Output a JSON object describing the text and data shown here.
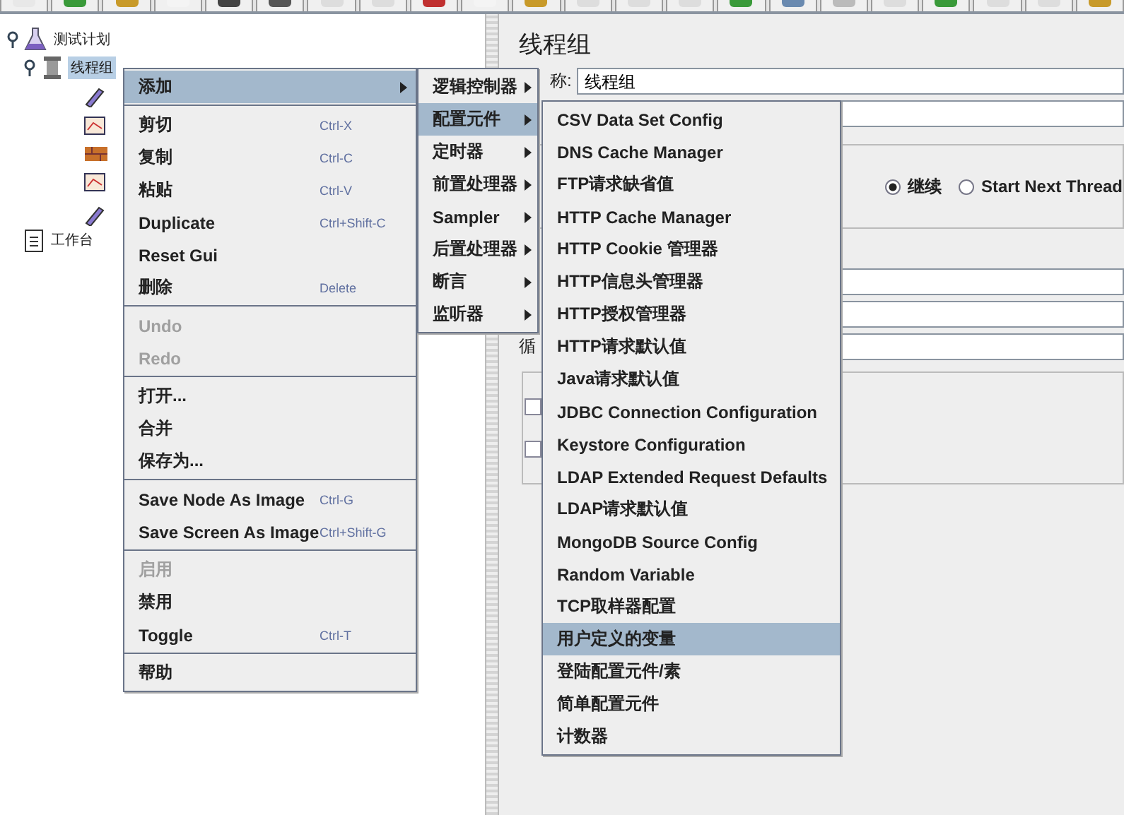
{
  "tree": [
    {
      "label": "测试计划",
      "selected": false,
      "children": [
        {
          "label": "线程组",
          "selected": true
        }
      ]
    },
    {
      "label": "工作台",
      "selected": false
    }
  ],
  "panel": {
    "title": "线程组",
    "name_label": "称:",
    "name_value": "线程组",
    "loop_label": "循",
    "checkboxes": [
      {
        "checked": false
      },
      {
        "checked": false
      }
    ],
    "radios": [
      {
        "label": "继续",
        "selected": true
      },
      {
        "label": "Start Next Thread",
        "selected": false
      }
    ]
  },
  "context_menu": [
    {
      "kind": "item",
      "label": "添加",
      "submenu": true,
      "selected": true,
      "disabled": false
    },
    {
      "kind": "separator"
    },
    {
      "kind": "item",
      "label": "剪切",
      "shortcut": "Ctrl-X",
      "selected": false,
      "disabled": false
    },
    {
      "kind": "item",
      "label": "复制",
      "shortcut": "Ctrl-C",
      "selected": false,
      "disabled": false
    },
    {
      "kind": "item",
      "label": "粘贴",
      "shortcut": "Ctrl-V",
      "selected": false,
      "disabled": false
    },
    {
      "kind": "item",
      "label": "Duplicate",
      "shortcut": "Ctrl+Shift-C",
      "selected": false,
      "disabled": false
    },
    {
      "kind": "item",
      "label": "Reset Gui",
      "selected": false,
      "disabled": false
    },
    {
      "kind": "item",
      "label": "删除",
      "shortcut": "Delete",
      "selected": false,
      "disabled": false
    },
    {
      "kind": "separator"
    },
    {
      "kind": "item",
      "label": "Undo",
      "selected": false,
      "disabled": true
    },
    {
      "kind": "item",
      "label": "Redo",
      "selected": false,
      "disabled": true
    },
    {
      "kind": "separator"
    },
    {
      "kind": "item",
      "label": "打开...",
      "selected": false,
      "disabled": false
    },
    {
      "kind": "item",
      "label": "合并",
      "selected": false,
      "disabled": false
    },
    {
      "kind": "item",
      "label": "保存为...",
      "selected": false,
      "disabled": false
    },
    {
      "kind": "separator"
    },
    {
      "kind": "item",
      "label": "Save Node As Image",
      "shortcut": "Ctrl-G",
      "selected": false,
      "disabled": false
    },
    {
      "kind": "item",
      "label": "Save Screen As Image",
      "shortcut": "Ctrl+Shift-G",
      "selected": false,
      "disabled": false
    },
    {
      "kind": "separator"
    },
    {
      "kind": "item",
      "label": "启用",
      "selected": false,
      "disabled": true
    },
    {
      "kind": "item",
      "label": "禁用",
      "selected": false,
      "disabled": false
    },
    {
      "kind": "item",
      "label": "Toggle",
      "shortcut": "Ctrl-T",
      "selected": false,
      "disabled": false
    },
    {
      "kind": "separator"
    },
    {
      "kind": "item",
      "label": "帮助",
      "selected": false,
      "disabled": false
    }
  ],
  "add_submenu": [
    {
      "label": "逻辑控制器",
      "selected": false
    },
    {
      "label": "配置元件",
      "selected": true
    },
    {
      "label": "定时器",
      "selected": false
    },
    {
      "label": "前置处理器",
      "selected": false
    },
    {
      "label": "Sampler",
      "selected": false
    },
    {
      "label": "后置处理器",
      "selected": false
    },
    {
      "label": "断言",
      "selected": false
    },
    {
      "label": "监听器",
      "selected": false
    }
  ],
  "config_submenu": [
    {
      "label": "CSV Data Set Config",
      "selected": false
    },
    {
      "label": "DNS Cache Manager",
      "selected": false
    },
    {
      "label": "FTP请求缺省值",
      "selected": false
    },
    {
      "label": "HTTP Cache Manager",
      "selected": false
    },
    {
      "label": "HTTP Cookie 管理器",
      "selected": false
    },
    {
      "label": "HTTP信息头管理器",
      "selected": false
    },
    {
      "label": "HTTP授权管理器",
      "selected": false
    },
    {
      "label": "HTTP请求默认值",
      "selected": false
    },
    {
      "label": "Java请求默认值",
      "selected": false
    },
    {
      "label": "JDBC Connection Configuration",
      "selected": false
    },
    {
      "label": "Keystore Configuration",
      "selected": false
    },
    {
      "label": "LDAP Extended Request Defaults",
      "selected": false
    },
    {
      "label": "LDAP请求默认值",
      "selected": false
    },
    {
      "label": "MongoDB Source Config",
      "selected": false
    },
    {
      "label": "Random Variable",
      "selected": false
    },
    {
      "label": "TCP取样器配置",
      "selected": false
    },
    {
      "label": "用户定义的变量",
      "selected": true
    },
    {
      "label": "登陆配置元件/素",
      "selected": false
    },
    {
      "label": "简单配置元件",
      "selected": false
    },
    {
      "label": "计数器",
      "selected": false
    }
  ]
}
